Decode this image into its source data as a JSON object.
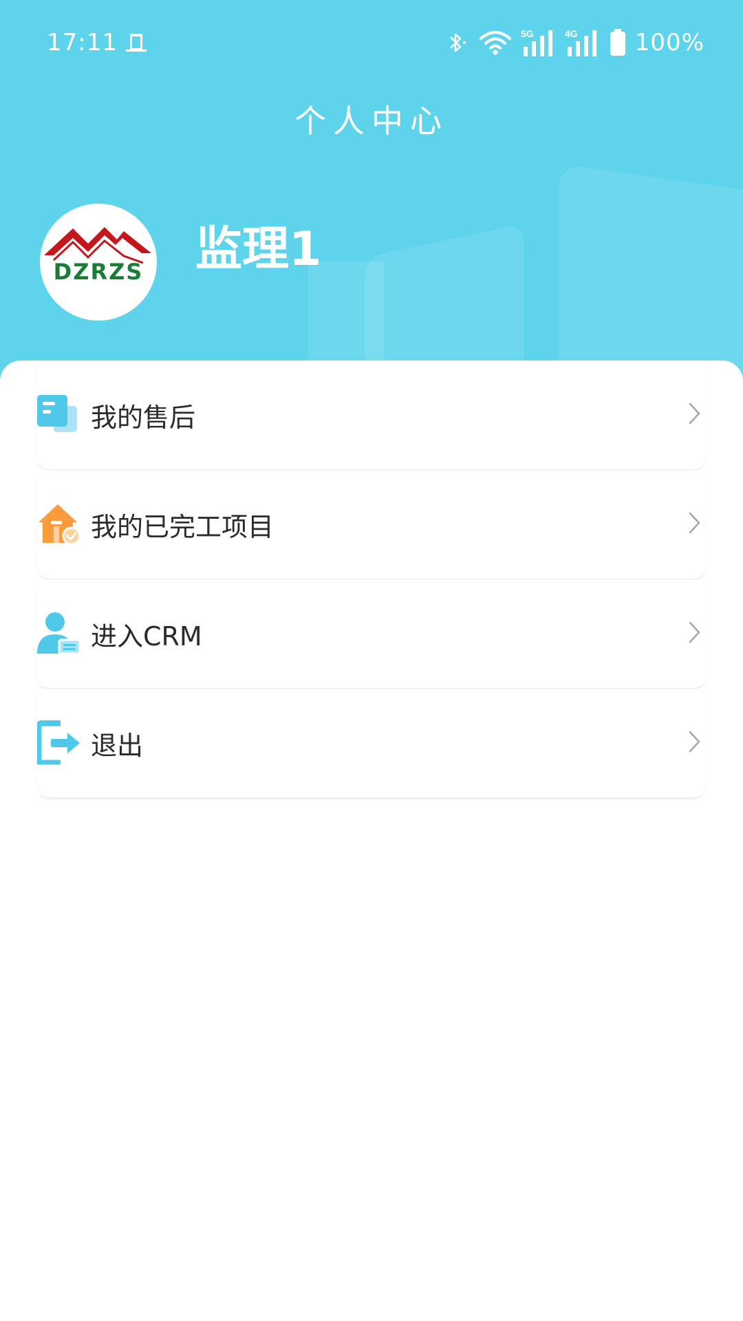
{
  "status_bar": {
    "time": "17:11",
    "battery": "100%",
    "network_1": "5G",
    "network_2": "4G"
  },
  "header": {
    "title": "个人中心",
    "username": "监理1",
    "avatar_logo": "DZRZS",
    "background_color": "#5dd3ec"
  },
  "menu": {
    "items": [
      {
        "label": "我的售后",
        "icon": "after-sales-icon"
      },
      {
        "label": "我的已完工项目",
        "icon": "completed-projects-icon"
      },
      {
        "label": "进入CRM",
        "icon": "crm-user-icon"
      },
      {
        "label": "退出",
        "icon": "logout-icon"
      }
    ]
  },
  "colors": {
    "accent": "#5dd3ec",
    "icon_blue": "#4fc8ea",
    "icon_orange": "#fb9b3c",
    "text": "#2b2b2b",
    "arrow": "#a6a6a6"
  }
}
